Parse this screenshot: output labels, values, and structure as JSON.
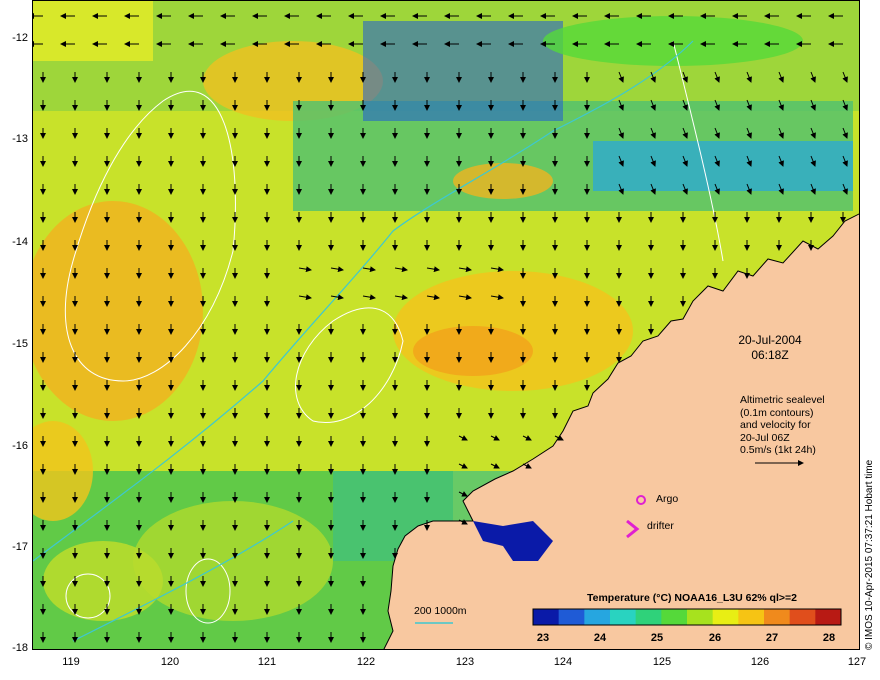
{
  "map": {
    "lat_labels": [
      "-12",
      "-13",
      "-14",
      "-15",
      "-16",
      "-17",
      "-18"
    ],
    "lon_labels": [
      "119",
      "120",
      "121",
      "122",
      "123",
      "124",
      "125",
      "126",
      "127"
    ]
  },
  "date": {
    "line1": "20-Jul-2004",
    "line2": "06:18Z"
  },
  "info": {
    "lines": [
      "Altimetric sealevel",
      "(0.1m contours)",
      "and velocity for",
      "20-Jul 06Z",
      "0.5m/s (1kt 24h)"
    ]
  },
  "legend": {
    "argo": "Argo",
    "drifter": "drifter",
    "depth": "200  1000m"
  },
  "colorbar": {
    "title": "Temperature (°C) NOAA16_L3U 62% ql>=2",
    "ticks": [
      "23",
      "24",
      "25",
      "26",
      "27",
      "28"
    ],
    "colors": [
      "#0a1aa8",
      "#1f5bd6",
      "#26a6e0",
      "#29d3c0",
      "#2fd27a",
      "#55d93a",
      "#a7e21e",
      "#e8ee14",
      "#f6c414",
      "#f08a1c",
      "#e04e1c",
      "#b81a14"
    ]
  },
  "credit": "© IMOS 10-Apr-2015 07:37:21 Hobart time",
  "colors": {
    "land": "#f8c8a0",
    "warm": "#f2a21a",
    "mid": "#cfe62a",
    "cool": "#2fae8a",
    "cold": "#1a2fa8",
    "contour": "#ffffff",
    "isobath": "#3ec8d0",
    "argo": "#e020d0"
  }
}
